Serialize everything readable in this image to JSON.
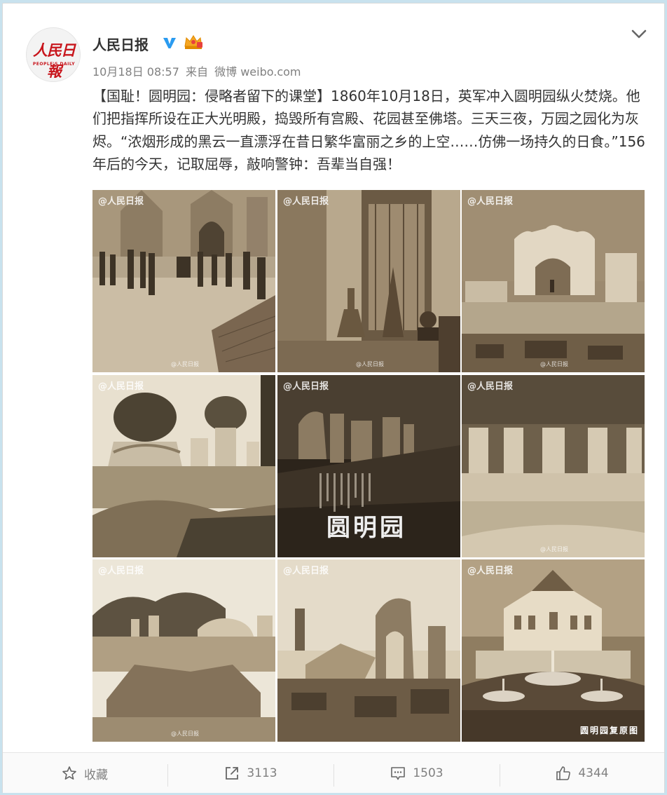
{
  "post": {
    "author": "人民日报",
    "avatar_text_cn": "人民日報",
    "avatar_text_en": "PEOPLE'S DAILY",
    "verified_icon": "verified-v-icon",
    "member_icon": "crown-member-icon",
    "timestamp": "10月18日 08:57",
    "source_prefix": "来自",
    "source": "微博 weibo.com",
    "text": "【国耻！圆明园：侵略者留下的课堂】1860年10月18日，英军冲入圆明园纵火焚烧。他们把指挥所设在正大光明殿，捣毁所有宫殿、花园甚至佛塔。三天三夜，万园之园化为灰烬。“浓烟形成的黑云一直漂浮在昔日繁华富丽之乡的上空……仿佛一场持久的日食。”156年后的今天，记取屈辱，敲响警钟：吾辈当自强！"
  },
  "images": {
    "watermark": "@人民日报",
    "watermark_small": "@人民日报",
    "caption_5": "圆明园",
    "caption_9": "圆明园复原图"
  },
  "actions": {
    "favorite_label": "收藏",
    "repost_count": "3113",
    "comment_count": "1503",
    "like_count": "4344"
  },
  "colors": {
    "page_bg": "#c8e2ee",
    "text": "#333333",
    "meta": "#808080",
    "brand_red": "#c8161d",
    "verified_blue": "#2a9bf0"
  }
}
